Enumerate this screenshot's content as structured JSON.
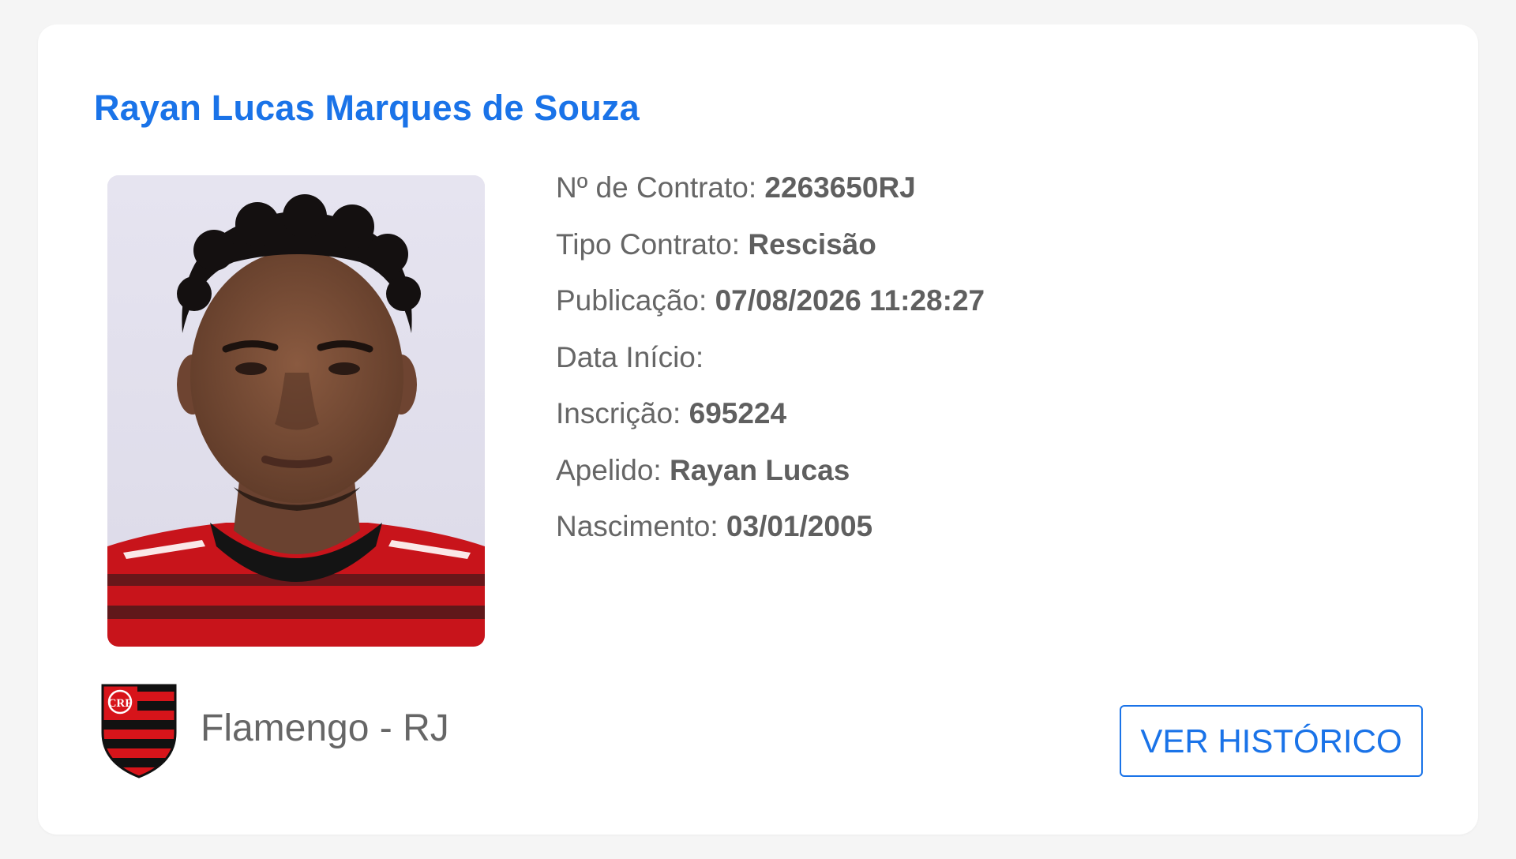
{
  "player": {
    "name": "Rayan Lucas Marques de Souza",
    "photo_icon": "player-photo"
  },
  "details": [
    {
      "label": "Nº de Contrato: ",
      "value": "2263650RJ"
    },
    {
      "label": "Tipo Contrato: ",
      "value": "Rescisão"
    },
    {
      "label": "Publicação: ",
      "value": "07/08/2026 11:28:27"
    },
    {
      "label": "Data Início: ",
      "value": ""
    },
    {
      "label": "Inscrição: ",
      "value": "695224"
    },
    {
      "label": "Apelido: ",
      "value": "Rayan Lucas"
    },
    {
      "label": "Nascimento: ",
      "value": "03/01/2005"
    }
  ],
  "club": {
    "name": "Flamengo - RJ",
    "crest_icon": "flamengo-crest-icon",
    "crest_monogram": "CRF",
    "colors": {
      "red": "#d7141a",
      "black": "#111111"
    }
  },
  "actions": {
    "history_label": "VER HISTÓRICO"
  },
  "theme": {
    "accent": "#1a73e8",
    "text": "#666666",
    "background": "#f5f5f5",
    "card": "#ffffff"
  }
}
